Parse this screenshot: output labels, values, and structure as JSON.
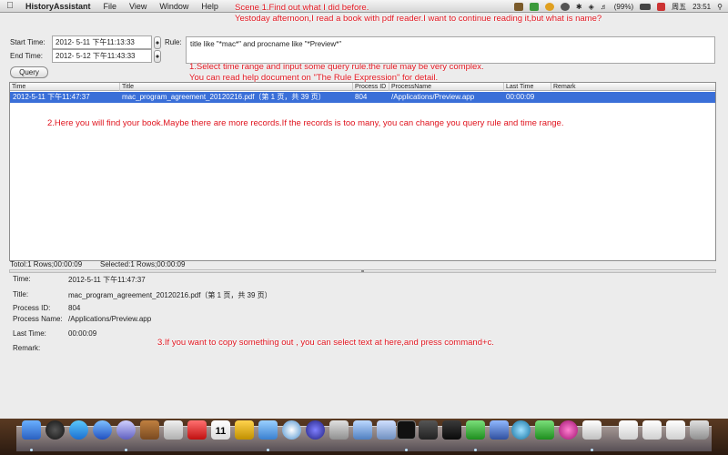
{
  "menubar": {
    "app_name": "HistoryAssistant",
    "items": [
      "File",
      "View",
      "Window",
      "Help"
    ],
    "battery": "(99%)",
    "day": "周五",
    "time": "23:51"
  },
  "form": {
    "start_label": "Start Time:",
    "start_value": "2012- 5-11 下午11:13:33",
    "end_label": "End Time:",
    "end_value": "2012- 5-12 下午11:43:33",
    "rule_label": "Rule:",
    "rule_value": "title like \"*mac*\" and procname like \"*Preview*\"",
    "query_button": "Query"
  },
  "table": {
    "columns": [
      "Time",
      "Title",
      "Process ID",
      "ProcessName",
      "Last Time",
      "Remark"
    ],
    "rows": [
      {
        "time": "2012-5-11 下午11:47:37",
        "title": "mac_program_agreement_20120216.pdf（第 1 页，共 39 页）",
        "pid": "804",
        "process": "/Applications/Preview.app",
        "last": "00:00:09",
        "remark": ""
      }
    ]
  },
  "summary": {
    "total": "Totol:1 Rows;00:00:09",
    "selected": "Selected:1 Rows;00:00:09"
  },
  "detail": {
    "time_label": "Time:",
    "time_value": "2012-5-11 下午11:47:37",
    "title_label": "Title:",
    "title_value": "mac_program_agreement_20120216.pdf（第 1 页，共 39 页）",
    "pid_label": "Process ID:",
    "pid_value": "804",
    "pname_label": "Process Name:",
    "pname_value": "/Applications/Preview.app",
    "last_label": "Last Time:",
    "last_value": "00:00:09",
    "remark_label": "Remark:"
  },
  "annotations": {
    "scene_line1": "Scene 1.Find out what I did before.",
    "scene_line2": "Yestoday afternoon,I read a book with pdf reader.I want to continue reading it,but what is name?",
    "step1_line1": "1.Select time range and input some query rule.the rule may be very complex.",
    "step1_line2": "You can read help document on \"The Rule Expression\" for detail.",
    "step2": "2.Here you will find your book.Maybe there are more records.If the records is too many, you can change you query rule and time range.",
    "step3": "3.If you want to copy something out , you can select text at here,and press command+c."
  },
  "colors": {
    "selection": "#3a6fd8",
    "annotation": "#e0141e"
  },
  "dock": {
    "apps": [
      "finder-icon",
      "dashboard-icon",
      "app-store-icon",
      "itunes-icon",
      "address-book-icon",
      "dictionary-icon",
      "calendar-icon",
      "qingting-icon",
      "safari-icon",
      "compass-icon",
      "launchpad-icon",
      "mail-icon",
      "xcode-icon",
      "terminal-icon",
      "activity-monitor-icon",
      "history-assistant-icon",
      "network-icon",
      "history-assistant-alt-icon",
      "photo-icon",
      "preview-icon",
      "document-icon",
      "document-icon",
      "trash-icon"
    ],
    "calendar_day": "11"
  }
}
